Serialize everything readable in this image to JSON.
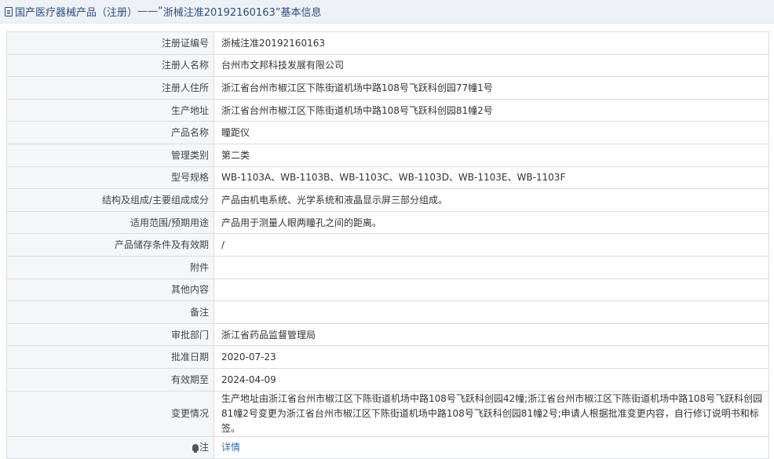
{
  "header": {
    "category": "国产医疗器械产品（注册）",
    "separator": " ——“",
    "reg_no": "浙械注准20192160163",
    "suffix": "”基本信息"
  },
  "rows": [
    {
      "label": "注册证编号",
      "value": "浙械注准20192160163"
    },
    {
      "label": "注册人名称",
      "value": "台州市文邦科技发展有限公司"
    },
    {
      "label": "注册人住所",
      "value": "浙江省台州市椒江区下陈街道机场中路108号飞跃科创园77幢1号"
    },
    {
      "label": "生产地址",
      "value": "浙江省台州市椒江区下陈街道机场中路108号飞跃科创园81幢2号"
    },
    {
      "label": "产品名称",
      "value": "瞳距仪"
    },
    {
      "label": "管理类别",
      "value": "第二类"
    },
    {
      "label": "型号规格",
      "value": "WB-1103A、WB-1103B、WB-1103C、WB-1103D、WB-1103E、WB-1103F"
    },
    {
      "label": "结构及组成/主要组成成分",
      "value": "产品由机电系统、光学系统和液晶显示屏三部分组成。"
    },
    {
      "label": "适用范围/预期用途",
      "value": "产品用于测量人眼两瞳孔之间的距离。"
    },
    {
      "label": "产品储存条件及有效期",
      "value": "/"
    },
    {
      "label": "附件",
      "value": ""
    },
    {
      "label": "其他内容",
      "value": ""
    },
    {
      "label": "备注",
      "value": ""
    },
    {
      "label": "审批部门",
      "value": "浙江省药品监督管理局"
    },
    {
      "label": "批准日期",
      "value": "2020-07-23"
    },
    {
      "label": "有效期至",
      "value": "2024-04-09"
    },
    {
      "label": "变更情况",
      "value": "生产地址由浙江省台州市椒江区下陈街道机场中路108号飞跃科创园42幢;浙江省台州市椒江区下陈街道机场中路108号飞跃科创园81幢2号变更为浙江省台州市椒江区下陈街道机场中路108号飞跃科创园81幢2号;申请人根据批准变更内容，自行修订说明书和标签。"
    }
  ],
  "note": {
    "label": "注",
    "link": "详情"
  }
}
